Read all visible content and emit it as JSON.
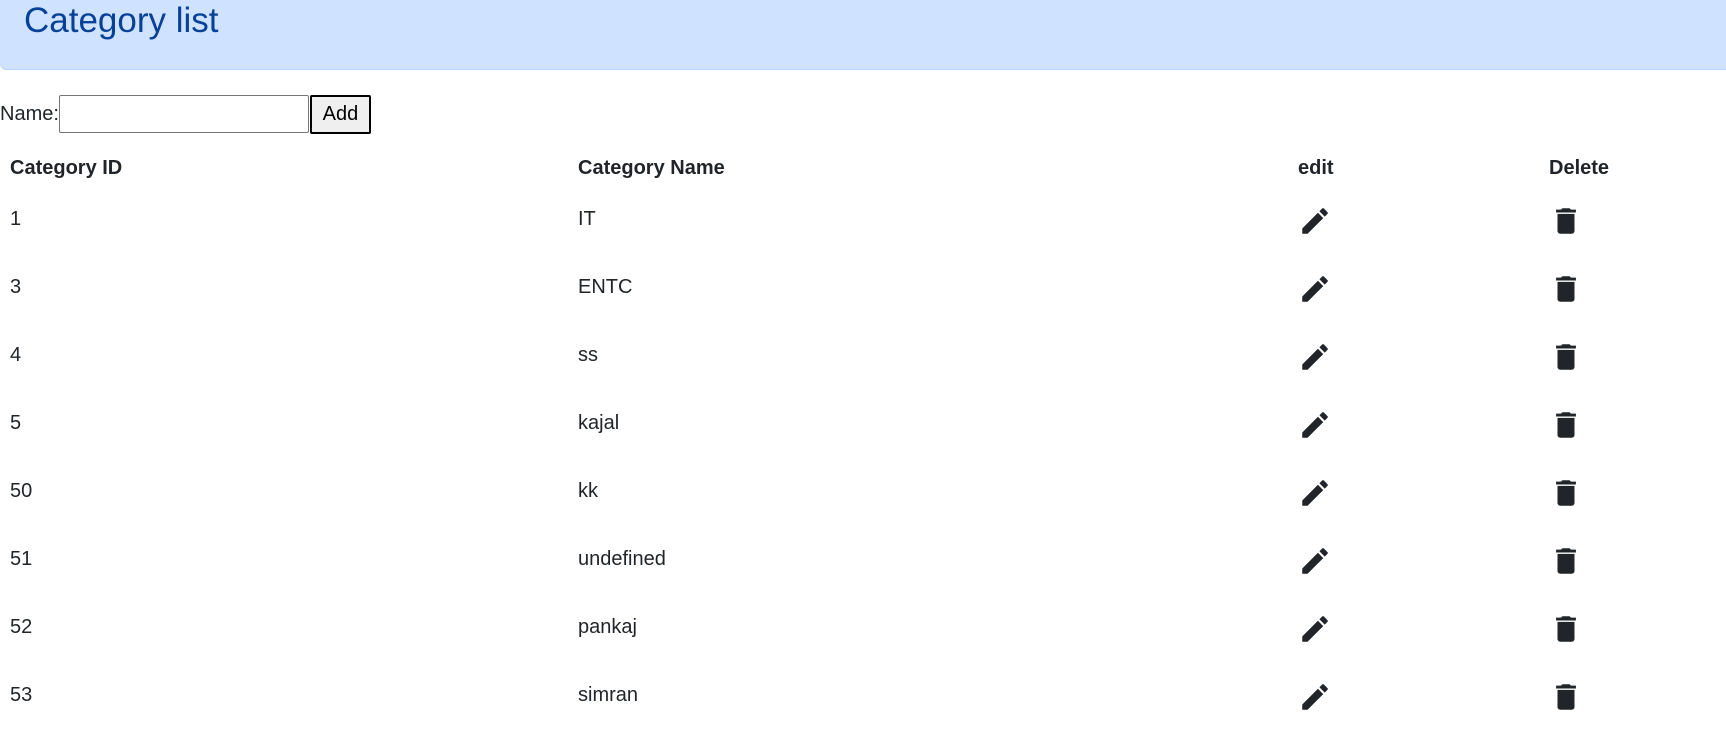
{
  "header": {
    "title": "Category list"
  },
  "form": {
    "name_label": "Name:",
    "name_value": "",
    "add_label": "Add"
  },
  "table": {
    "columns": [
      "Category ID",
      "Category Name",
      "edit",
      "Delete"
    ],
    "rows": [
      {
        "id": "1",
        "name": "IT"
      },
      {
        "id": "3",
        "name": "ENTC"
      },
      {
        "id": "4",
        "name": "ss"
      },
      {
        "id": "5",
        "name": "kajal"
      },
      {
        "id": "50",
        "name": "kk"
      },
      {
        "id": "51",
        "name": "undefined"
      },
      {
        "id": "52",
        "name": "pankaj"
      },
      {
        "id": "53",
        "name": "simran"
      }
    ]
  },
  "icons": {
    "edit": "pencil-icon",
    "delete": "trash-icon"
  },
  "colors": {
    "header_bg": "#cfe2ff",
    "header_text": "#084298",
    "icon": "#212529"
  }
}
